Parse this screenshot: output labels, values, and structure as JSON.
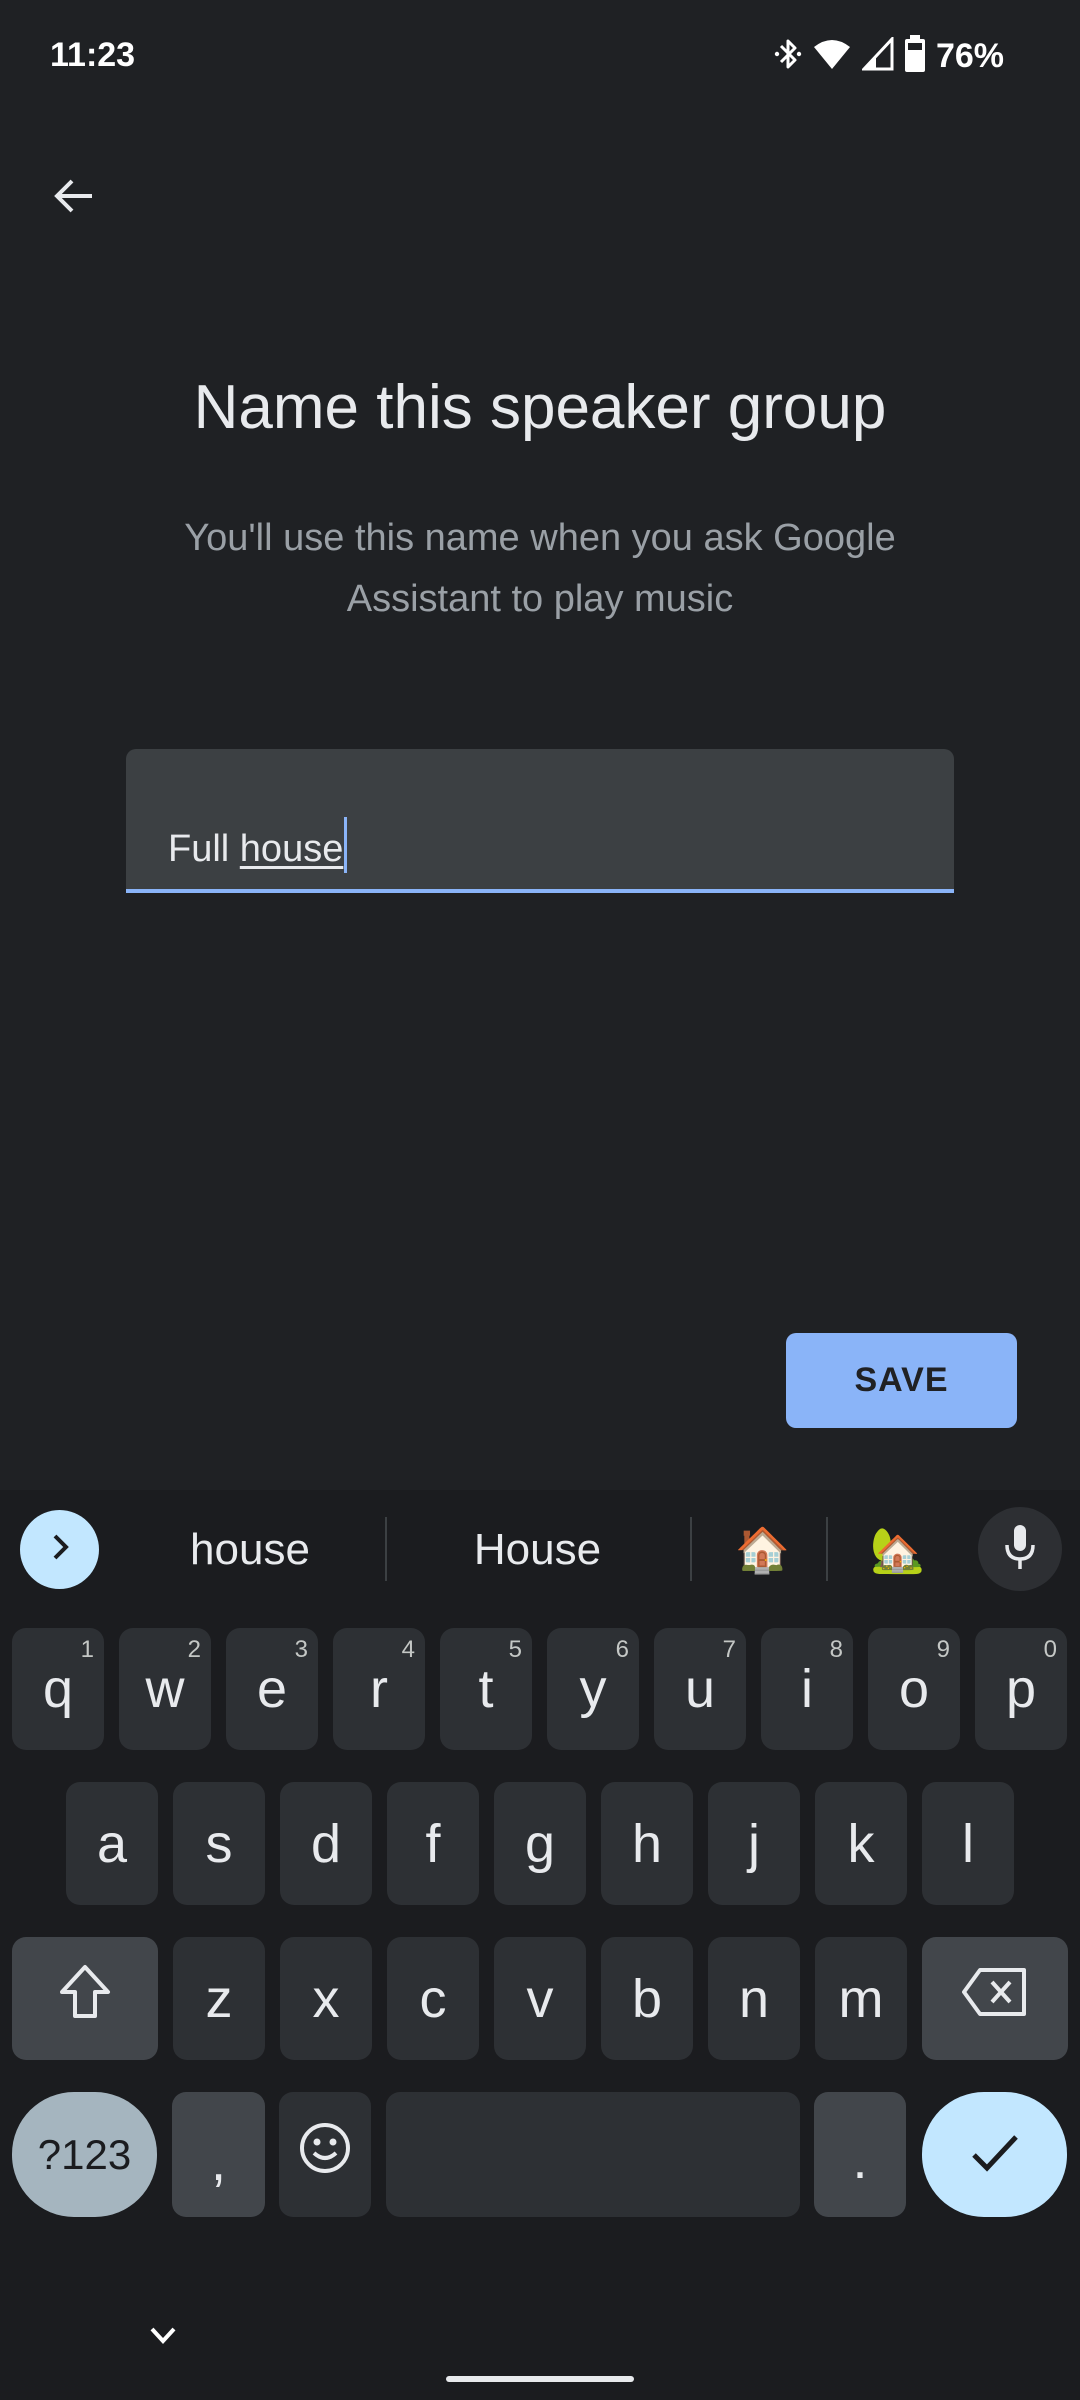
{
  "status_bar": {
    "time": "11:23",
    "battery_percent": "76%",
    "icons": [
      "bluetooth-icon",
      "wifi-icon",
      "cell-signal-icon",
      "battery-icon"
    ]
  },
  "header": {
    "back_icon": "arrow-back-icon"
  },
  "main": {
    "title": "Name this speaker group",
    "subtitle": "You'll use this name when you ask Google Assistant to play music",
    "name_field": {
      "value_prefix": "Full ",
      "value_composing": "house",
      "full_value": "Full house"
    },
    "save_label": "SAVE"
  },
  "colors": {
    "accent": "#8ab4f8",
    "background": "#1f2124",
    "field_bg": "#3c4043",
    "keyboard_bg": "#1b1c1f"
  },
  "keyboard": {
    "suggestions": [
      "house",
      "House",
      "🏠",
      "🏡"
    ],
    "row1": [
      {
        "key": "q",
        "hint": "1"
      },
      {
        "key": "w",
        "hint": "2"
      },
      {
        "key": "e",
        "hint": "3"
      },
      {
        "key": "r",
        "hint": "4"
      },
      {
        "key": "t",
        "hint": "5"
      },
      {
        "key": "y",
        "hint": "6"
      },
      {
        "key": "u",
        "hint": "7"
      },
      {
        "key": "i",
        "hint": "8"
      },
      {
        "key": "o",
        "hint": "9"
      },
      {
        "key": "p",
        "hint": "0"
      }
    ],
    "row2": [
      "a",
      "s",
      "d",
      "f",
      "g",
      "h",
      "j",
      "k",
      "l"
    ],
    "row3": [
      "z",
      "x",
      "c",
      "v",
      "b",
      "n",
      "m"
    ],
    "symbols_label": "?123",
    "comma": ",",
    "period": "."
  }
}
